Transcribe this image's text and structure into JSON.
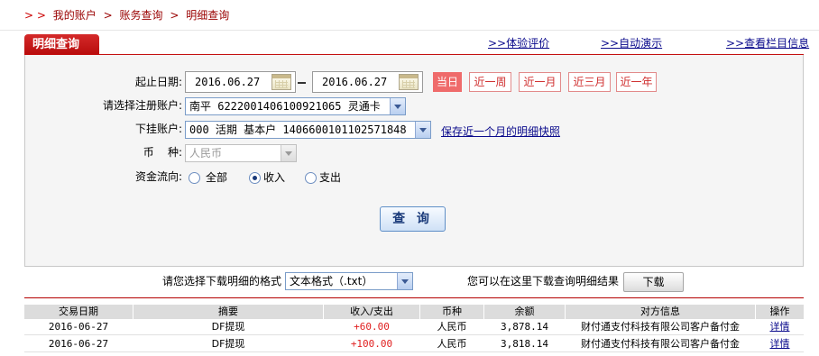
{
  "breadcrumb": {
    "arrows": "> >",
    "items": [
      "我的账户",
      "账务查询",
      "明细查询"
    ],
    "sep": ">"
  },
  "tab": {
    "title": "明细查询"
  },
  "toplinks": {
    "feedback": ">>体验评价",
    "auto_demo": ">>自动演示",
    "column_help": ">>查看栏目信息"
  },
  "form": {
    "date_label": "起止日期:",
    "start_date": "2016.06.27",
    "end_date": "2016.06.27",
    "quick_buttons": [
      "当日",
      "近一周",
      "近一月",
      "近三月",
      "近一年"
    ],
    "quick_active_index": 0,
    "account_label": "请选择注册账户:",
    "account_value": "南平 6222001406100921065 灵通卡",
    "sub_account_label": "下挂账户:",
    "sub_account_value": "000 活期 基本户 1406600101102571848",
    "save_snapshot_link": "保存近一个月的明细快照",
    "currency_label": "币    种:",
    "currency_value": "人民币",
    "flow_label": "资金流向:",
    "flow_options": [
      "全部",
      "收入",
      "支出"
    ],
    "flow_selected": "收入",
    "query_button": "查 询"
  },
  "download": {
    "format_label": "请您选择下载明细的格式",
    "format_value": "文本格式（.txt）",
    "hint": "您可以在这里下载查询明细结果",
    "button": "下载"
  },
  "table": {
    "headers": [
      "交易日期",
      "摘要",
      "收入/支出",
      "币种",
      "余额",
      "对方信息",
      "操作"
    ],
    "rows": [
      [
        "2016-06-27",
        "DF提现",
        "+60.00",
        "人民币",
        "3,878.14",
        "财付通支付科技有限公司客户备付金",
        "详情"
      ],
      [
        "2016-06-27",
        "DF提现",
        "+100.00",
        "人民币",
        "3,818.14",
        "财付通支付科技有限公司客户备付金",
        "详情"
      ]
    ]
  },
  "colors": {
    "brand_red": "#c40f0f",
    "link_blue": "#0a0a8c",
    "active_quick": "#ef6b6b",
    "income": "#e02020"
  }
}
